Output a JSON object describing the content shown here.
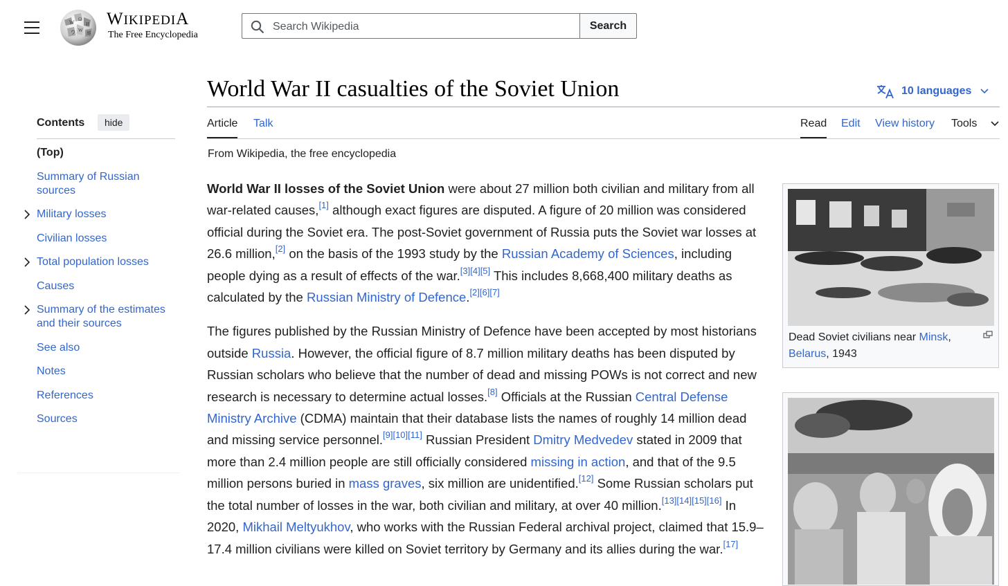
{
  "header": {
    "wordmark_first": "W",
    "wordmark_rest": "IKIPEDIA",
    "wordmark_last": "A",
    "tagline": "The Free Encyclopedia",
    "search_placeholder": "Search Wikipedia",
    "search_button": "Search"
  },
  "toc": {
    "title": "Contents",
    "hide_label": "hide",
    "items": [
      {
        "label": "(Top)"
      },
      {
        "label": "Summary of Russian sources"
      },
      {
        "label": "Military losses"
      },
      {
        "label": "Civilian losses"
      },
      {
        "label": "Total population losses"
      },
      {
        "label": "Causes"
      },
      {
        "label": "Summary of the estimates and their sources"
      },
      {
        "label": "See also"
      },
      {
        "label": "Notes"
      },
      {
        "label": "References"
      },
      {
        "label": "Sources"
      }
    ]
  },
  "article": {
    "title": "World War II casualties of the Soviet Union",
    "languages": "10 languages",
    "tabs": {
      "article": "Article",
      "talk": "Talk",
      "read": "Read",
      "edit": "Edit",
      "history": "View history",
      "tools": "Tools"
    },
    "from": "From Wikipedia, the free encyclopedia"
  },
  "thumbs": {
    "caption1_a": "Dead Soviet civilians near ",
    "caption1_link1": "Minsk",
    "caption1_b": ",",
    "caption1_link2": "Belarus",
    "caption1_c": ", 1943"
  },
  "para1": {
    "bold": "World War II losses of the Soviet Union",
    "t1": " were about 27 million both civilian and military from all war-related causes,",
    "r1": "[1]",
    "t2": " although exact figures are disputed. A figure of 20 million was considered official during the Soviet era. The post-Soviet government of Russia puts the Soviet war losses at 26.6 million,",
    "r2": "[2]",
    "t3": " on the basis of the 1993 study by the ",
    "l1": "Russian Academy of Sciences",
    "t4": ", including people dying as a result of effects of the war.",
    "r3": "[3][4][5]",
    "t5": " This includes 8,668,400 military deaths as calculated by the ",
    "l2": "Russian Ministry of Defence",
    "t6": ".",
    "r4": "[2][6][7]"
  },
  "para2": {
    "t1": "The figures published by the Russian Ministry of Defence have been accepted by most historians outside ",
    "l1": "Russia",
    "t2": ". However, the official figure of 8.7 million military deaths has been disputed by Russian scholars who believe that the number of dead and missing POWs is not correct and new research is necessary to determine actual losses.",
    "r1": "[8]",
    "t3": " Officials at the Russian ",
    "l2": "Central Defense Ministry Archive",
    "t4": " (CDMA) maintain that their database lists the names of roughly 14 million dead and missing service personnel.",
    "r2": "[9][10][11]",
    "t5": " Russian President ",
    "l3": "Dmitry Medvedev",
    "t6": " stated in 2009 that more than 2.4 million people are still officially considered ",
    "l4": "missing in action",
    "t7": ", and that of the 9.5 million persons buried in ",
    "l5": "mass graves",
    "t8": ", six million are unidentified.",
    "r3": "[12]",
    "t9": " Some Russian scholars put the total number of losses in the war, both civilian and military, at over 40 million.",
    "r4": "[13][14][15][16]",
    "t10": " In 2020, ",
    "l6": "Mikhail Meltyukhov",
    "t11": ", who works with the Russian Federal archival project, claimed that 15.9–17.4 million civilians were killed on Soviet territory by Germany and its allies during the war.",
    "r5": "[17]"
  }
}
